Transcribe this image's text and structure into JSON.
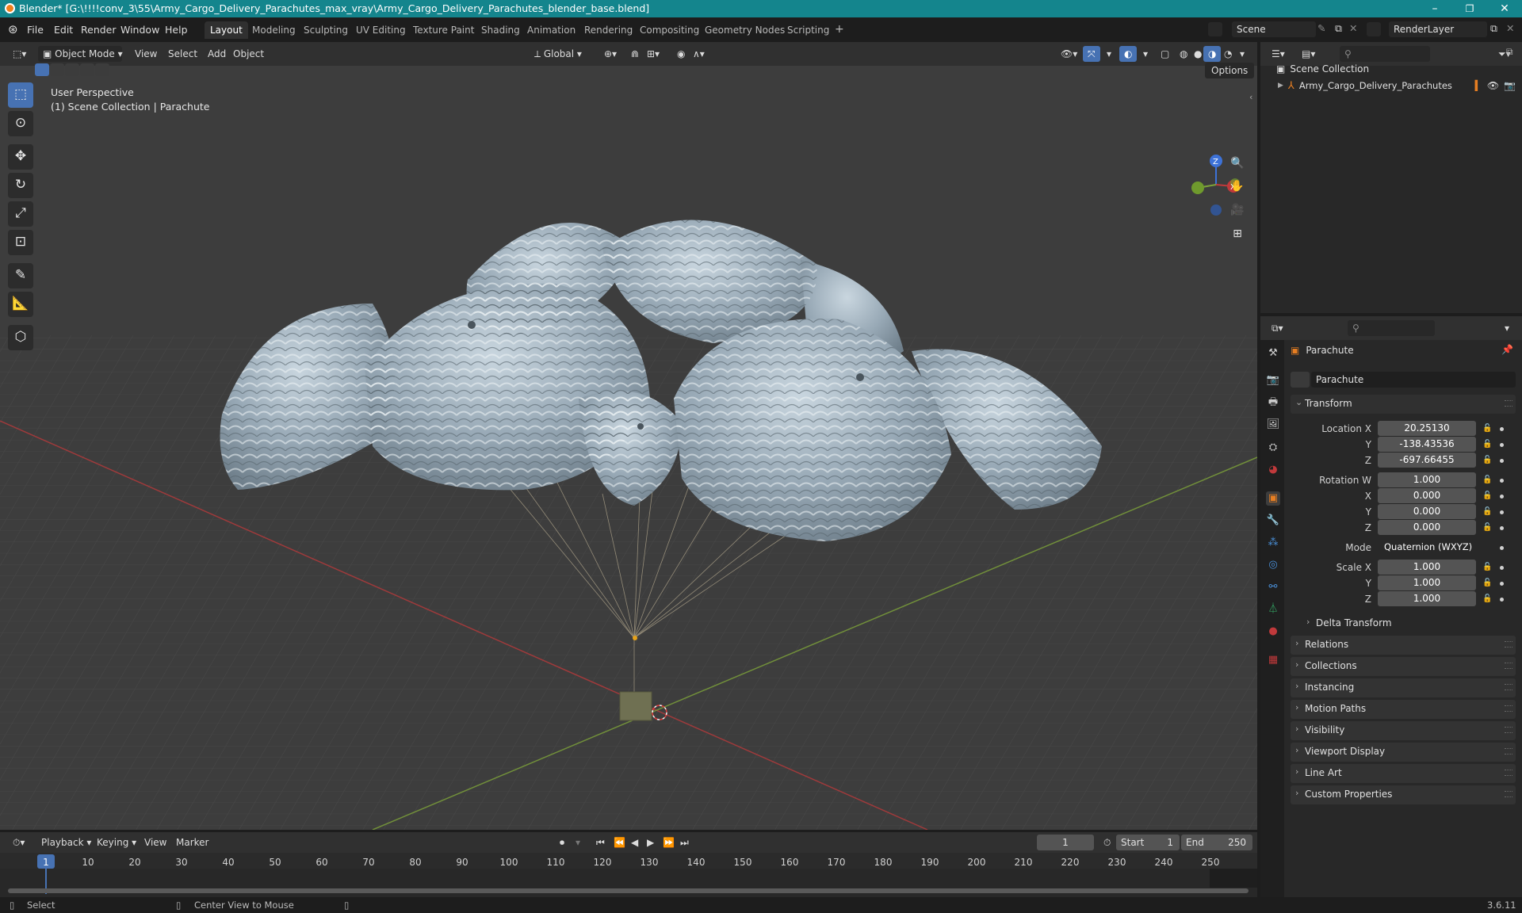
{
  "titlebar": {
    "title": "Blender* [G:\\!!!!conv_3\\55\\Army_Cargo_Delivery_Parachutes_max_vray\\Army_Cargo_Delivery_Parachutes_blender_base.blend]",
    "minimize": "–",
    "maximize": "❐",
    "close": "✕"
  },
  "menu": [
    "File",
    "Edit",
    "Render",
    "Window",
    "Help"
  ],
  "workspaces": [
    "Layout",
    "Modeling",
    "Sculpting",
    "UV Editing",
    "Texture Paint",
    "Shading",
    "Animation",
    "Rendering",
    "Compositing",
    "Geometry Nodes",
    "Scripting",
    "+"
  ],
  "active_workspace": "Layout",
  "scene": {
    "name": "Scene",
    "render_layer": "RenderLayer"
  },
  "viewport_header": {
    "mode": "Object Mode",
    "menus": [
      "View",
      "Select",
      "Add",
      "Object"
    ],
    "orientation": "Global",
    "options": "Options"
  },
  "viewport": {
    "perspective": "User Perspective",
    "collection_info": "(1) Scene Collection | Parachute",
    "gizmo": {
      "z": "Z",
      "y": "Y",
      "x": "X"
    }
  },
  "outliner": {
    "root": "Scene Collection",
    "items": [
      {
        "name": "Army_Cargo_Delivery_Parachutes"
      }
    ]
  },
  "properties": {
    "object_name": "Parachute",
    "data_name": "Parachute",
    "transform_label": "Transform",
    "location": {
      "label": "Location X",
      "x": "20.25130",
      "y": "-138.43536",
      "z": "-697.66455"
    },
    "rotation": {
      "label": "Rotation W",
      "w": "1.000",
      "x": "0.000",
      "y": "0.000",
      "z": "0.000"
    },
    "mode": {
      "label": "Mode",
      "value": "Quaternion (WXYZ)"
    },
    "scale": {
      "label": "Scale X",
      "x": "1.000",
      "y": "1.000",
      "z": "1.000"
    },
    "axis_labels": {
      "y": "Y",
      "z": "Z",
      "x": "X"
    },
    "delta_transform": "Delta Transform",
    "panels": [
      "Relations",
      "Collections",
      "Instancing",
      "Motion Paths",
      "Visibility",
      "Viewport Display",
      "Line Art",
      "Custom Properties"
    ]
  },
  "timeline": {
    "menus": [
      "Playback",
      "Keying",
      "View",
      "Marker"
    ],
    "current_frame": "1",
    "start_label": "Start",
    "start": "1",
    "end_label": "End",
    "end": "250",
    "ticks": [
      "1",
      "10",
      "20",
      "30",
      "40",
      "50",
      "60",
      "70",
      "80",
      "90",
      "100",
      "110",
      "120",
      "130",
      "140",
      "150",
      "160",
      "170",
      "180",
      "190",
      "200",
      "210",
      "220",
      "230",
      "240",
      "250"
    ]
  },
  "statusbar": {
    "select": "Select",
    "center_view": "Center View to Mouse",
    "version": "3.6.11"
  },
  "colors": {
    "accent": "#4772b3",
    "titlebar": "#14858d",
    "x_axis": "#c0393b",
    "y_axis": "#7ea43a",
    "z_axis": "#3d72d8",
    "object_orange": "#e67e22"
  }
}
